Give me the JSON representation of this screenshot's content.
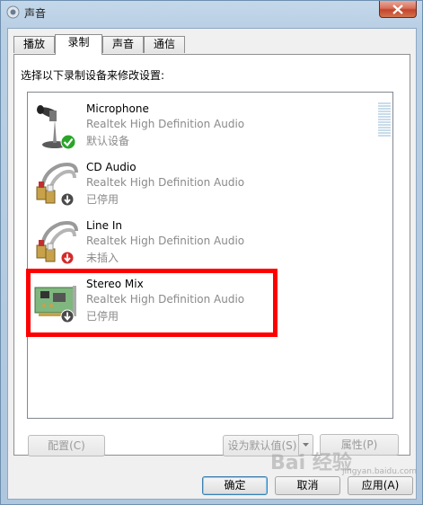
{
  "window": {
    "title": "声音",
    "close_icon": "close-icon"
  },
  "tabs": [
    {
      "label": "播放",
      "active": false
    },
    {
      "label": "录制",
      "active": true
    },
    {
      "label": "声音",
      "active": false
    },
    {
      "label": "通信",
      "active": false
    }
  ],
  "instruction": "选择以下录制设备来修改设置:",
  "devices": [
    {
      "name": "Microphone",
      "driver": "Realtek High Definition Audio",
      "status": "默认设备",
      "icon": "microphone-icon",
      "badge": "default-check-icon"
    },
    {
      "name": "CD Audio",
      "driver": "Realtek High Definition Audio",
      "status": "已停用",
      "icon": "rca-cable-icon",
      "badge": "disabled-arrow-icon"
    },
    {
      "name": "Line In",
      "driver": "Realtek High Definition Audio",
      "status": "未插入",
      "icon": "rca-cable-icon",
      "badge": "unplugged-arrow-icon"
    },
    {
      "name": "Stereo Mix",
      "driver": "Realtek High Definition Audio",
      "status": "已停用",
      "icon": "sound-card-icon",
      "badge": "disabled-arrow-icon"
    }
  ],
  "buttons": {
    "configure": "配置(C)",
    "set_default": "设为默认值(S)",
    "properties": "属性(P)",
    "ok": "确定",
    "cancel": "取消",
    "apply": "应用(A)"
  },
  "watermark": {
    "text": "Bai 经验",
    "sub": "jingyan.baidu.com"
  },
  "colors": {
    "highlight": "#ff0000",
    "check_green": "#2aa52a",
    "unplugged_red": "#d42a2a"
  }
}
